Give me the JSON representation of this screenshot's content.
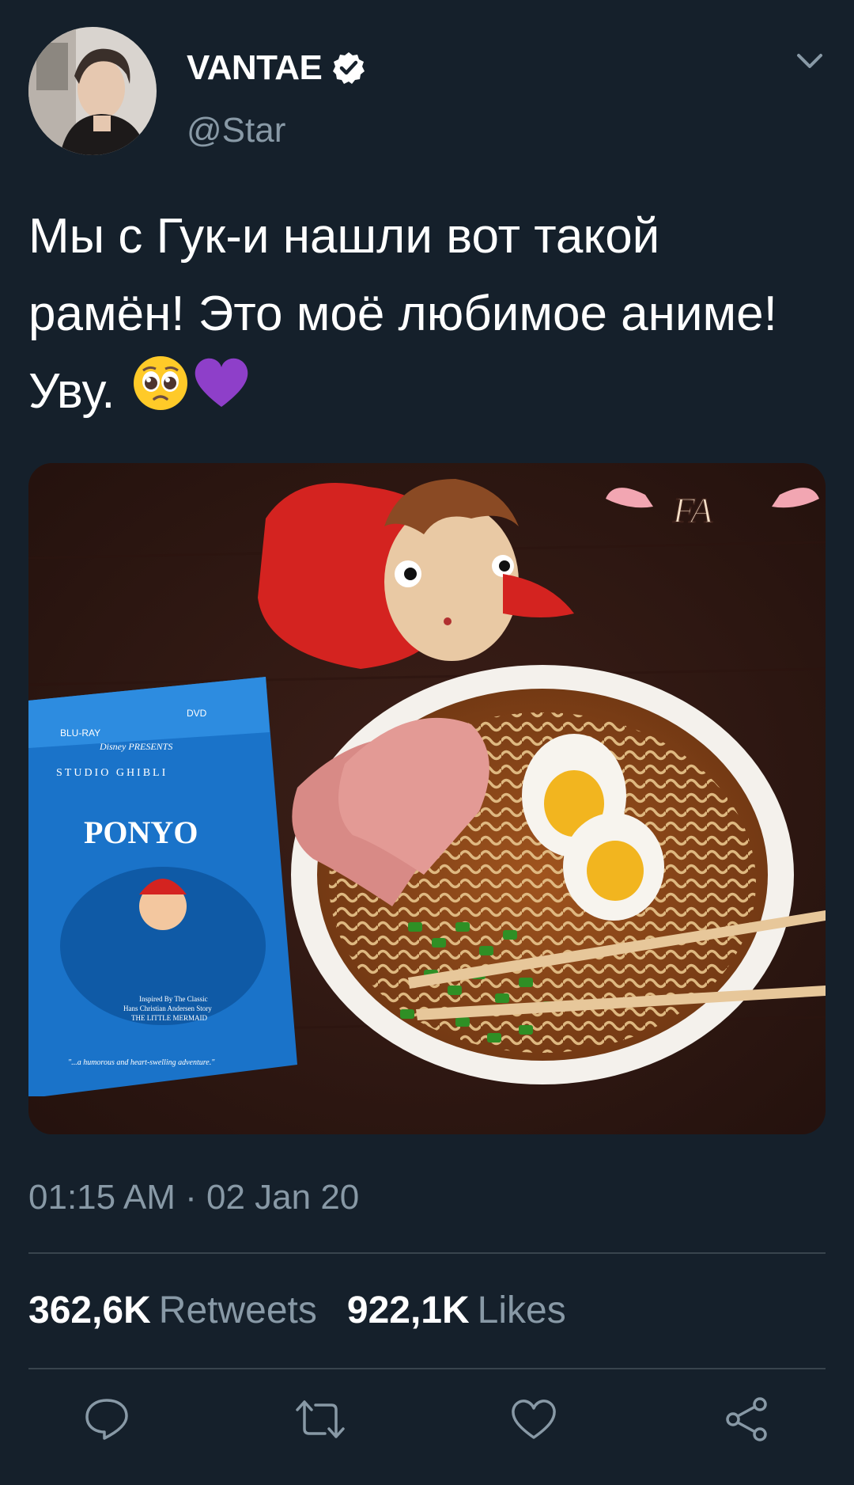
{
  "author": {
    "display_name": "VANTAE",
    "handle": "@Star",
    "verified": true
  },
  "tweet": {
    "text": "Мы с Гук-и нашли вот такой рамён! Это моё любимое аниме! Уву.",
    "emojis": [
      "pleading-face-emoji",
      "purple-heart-emoji"
    ],
    "timestamp": "01:15 AM · 02 Jan 20"
  },
  "photo": {
    "watermark": "FA",
    "dvd": {
      "bluray": "BLU-RAY",
      "dvd_label": "DVD",
      "presents": "Disney PRESENTS",
      "studio": "STUDIO GHIBLI",
      "title": "PONYO",
      "inspired": "Inspired By The Classic",
      "author": "Hans Christian Andersen Story",
      "story": "THE LITTLE MERMAID",
      "quote": "\"...a humorous and heart-swelling adventure.\""
    }
  },
  "stats": {
    "retweets_count": "362,6K",
    "retweets_label": "Retweets",
    "likes_count": "922,1K",
    "likes_label": "Likes"
  },
  "colors": {
    "background": "#15202b",
    "secondary_text": "#8899a6",
    "divider": "#38444d"
  }
}
